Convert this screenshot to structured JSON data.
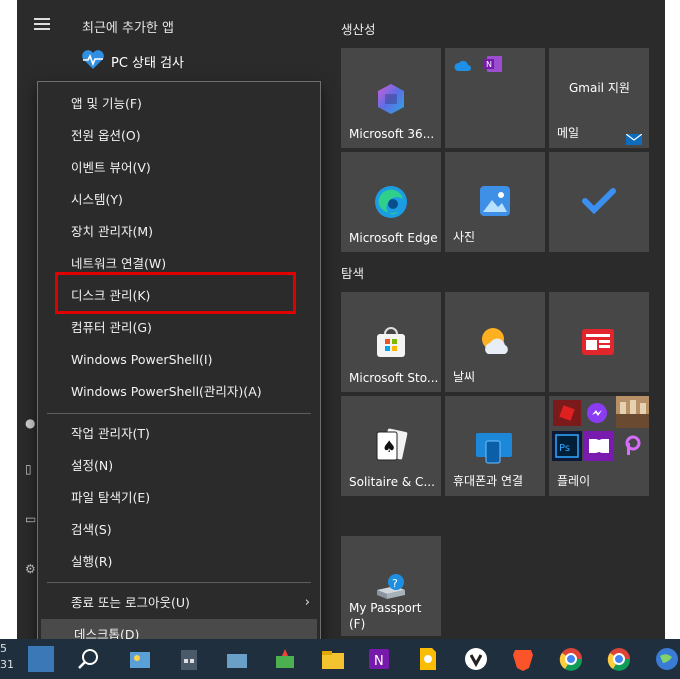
{
  "start_menu": {
    "recent_title": "최근에 추가한 앱",
    "pc_health_label": "PC 상태 검사"
  },
  "context_menu": {
    "items": [
      {
        "label": "앱 및 기능(F)"
      },
      {
        "label": "전원 옵션(O)"
      },
      {
        "label": "이벤트 뷰어(V)"
      },
      {
        "label": "시스템(Y)"
      },
      {
        "label": "장치 관리자(M)"
      },
      {
        "label": "네트워크 연결(W)"
      },
      {
        "label": "디스크 관리(K)"
      },
      {
        "label": "컴퓨터 관리(G)"
      },
      {
        "label": "Windows PowerShell(I)"
      },
      {
        "label": "Windows PowerShell(관리자)(A)"
      },
      {
        "label": "작업 관리자(T)"
      },
      {
        "label": "설정(N)"
      },
      {
        "label": "파일 탐색기(E)"
      },
      {
        "label": "검색(S)"
      },
      {
        "label": "실행(R)"
      },
      {
        "label": "종료 또는 로그아웃(U)"
      },
      {
        "label": "데스크톱(D)"
      }
    ],
    "highlight_color": "#e00000"
  },
  "tiles": {
    "section_productivity": "생산성",
    "section_explore": "탐색",
    "microsoft365": "Microsoft 36...",
    "gmail": "Gmail 지원",
    "mail": "메일",
    "edge": "Microsoft Edge",
    "photos": "사진",
    "store": "Microsoft Sto...",
    "weather": "날씨",
    "solitaire": "Solitaire & C...",
    "phone_link": "휴대폰과 연결",
    "play": "플레이",
    "my_passport_line1": "My Passport",
    "my_passport_line2": "(F)"
  },
  "taskbar": {
    "clock_line1": "5",
    "clock_line2": "31"
  }
}
